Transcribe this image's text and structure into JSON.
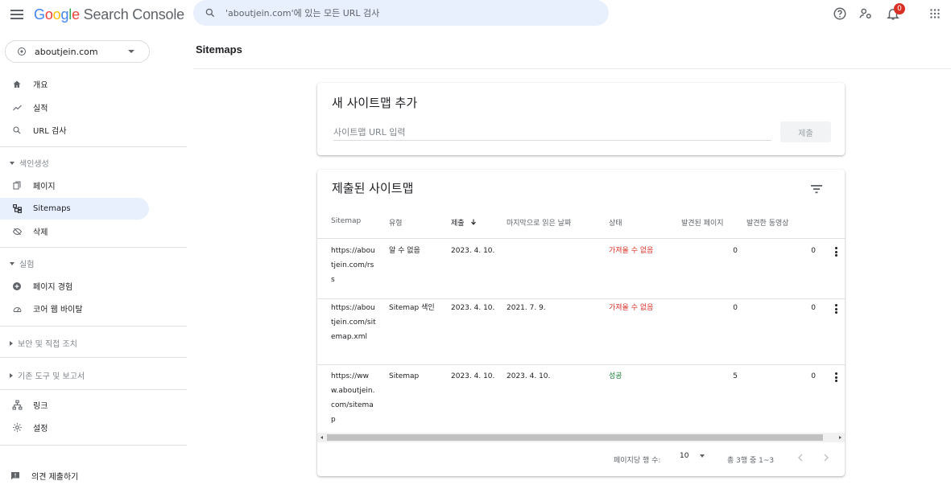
{
  "app": {
    "name_parts": [
      "G",
      "o",
      "o",
      "g",
      "l",
      "e"
    ],
    "name_rest": " Search Console"
  },
  "search": {
    "placeholder": "'aboutjein.com'에 있는 모든 URL 검사"
  },
  "notifications": {
    "count": "0"
  },
  "property": {
    "name": "aboutjein.com"
  },
  "sidebar": {
    "items": [
      {
        "label": "개요",
        "icon": "home-icon"
      },
      {
        "label": "실적",
        "icon": "trending-up-icon"
      },
      {
        "label": "URL 검사",
        "icon": "search-icon"
      }
    ],
    "section_indexing": "색인생성",
    "indexing_items": [
      {
        "label": "페이지",
        "icon": "pages-icon"
      },
      {
        "label": "Sitemaps",
        "icon": "sitemap-icon",
        "active": true
      },
      {
        "label": "삭제",
        "icon": "eye-off-icon"
      }
    ],
    "section_experience": "실험",
    "experience_items": [
      {
        "label": "페이지 경험",
        "icon": "add-circle-icon"
      },
      {
        "label": "코어 웹 바이탈",
        "icon": "speed-gauge-icon"
      }
    ],
    "section_security": "보안 및 직접 조치",
    "section_legacy": "기존 도구 및 보고서",
    "bottom_items": [
      {
        "label": "링크",
        "icon": "links-icon"
      },
      {
        "label": "설정",
        "icon": "settings-icon"
      }
    ],
    "feedback": "의견 제출하기"
  },
  "page": {
    "title": "Sitemaps"
  },
  "add_sitemap": {
    "title": "새 사이트맵 추가",
    "input_placeholder": "사이트맵 URL 입력",
    "submit_label": "제출"
  },
  "submitted": {
    "title": "제출된 사이트맵",
    "columns": [
      "Sitemap",
      "유형",
      "제출",
      "마지막으로 읽은 날짜",
      "상태",
      "발견된 페이지",
      "발견한 동영상"
    ],
    "rows": [
      {
        "sitemap": "https://aboutjein.com/rss",
        "type": "알 수 없음",
        "submitted": "2023. 4. 10.",
        "last_read": "",
        "status": "가져올 수 없음",
        "pages": "0",
        "videos": "0"
      },
      {
        "sitemap": "https://aboutjein.com/sitemap.xml",
        "type": "Sitemap 색인",
        "submitted": "2023. 4. 10.",
        "last_read": "2021. 7. 9.",
        "status": "가져올 수 없음",
        "pages": "0",
        "videos": "0"
      },
      {
        "sitemap": "https://www.aboutjein.com/sitemap",
        "type": "Sitemap",
        "submitted": "2023. 4. 10.",
        "last_read": "2023. 4. 10.",
        "status": "성공",
        "pages": "5",
        "videos": "0"
      }
    ],
    "pager_label": "페이지당 행 수:",
    "rows_per_page": "10",
    "range": "총 3행 중 1~3"
  },
  "colors": {
    "accent": "#1a73e8",
    "active_bg": "#e8f0fe",
    "error": "#d93025",
    "success": "#188038"
  }
}
